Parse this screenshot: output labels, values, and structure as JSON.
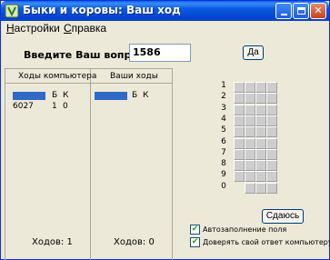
{
  "window": {
    "title": "Быки и коровы: Ваш ход",
    "icon": "bulls-and-cows-app-icon",
    "minimize": "minimize-icon",
    "maximize": "maximize-icon",
    "close": "✕"
  },
  "menu": {
    "items": [
      {
        "first": "Н",
        "rest": "астройки"
      },
      {
        "first": "С",
        "rest": "правка"
      }
    ]
  },
  "question": {
    "label": "Введите Ваш вопрос",
    "value": "1586",
    "submit_label": "Да"
  },
  "computer_moves": {
    "header": "Ходы компьютера",
    "bulls_label": "Б",
    "cows_label": "К",
    "rows": [
      {
        "guess": "6027",
        "bulls": "1",
        "cows": "0"
      }
    ],
    "count_label": "Ходов: 1"
  },
  "your_moves": {
    "header": "Ваши ходы",
    "bulls_label": "Б",
    "cows_label": "К",
    "rows": [],
    "count_label": "Ходов: 0"
  },
  "digits_grid": {
    "rows": [
      "1",
      "2",
      "3",
      "4",
      "5",
      "6",
      "7",
      "8",
      "9",
      "0"
    ]
  },
  "give_up_label": "Сдаюсь",
  "options": {
    "autofill_label": "Автозаполнение поля",
    "autofill_checked": true,
    "trust_label": "Доверять свой ответ компьютеру",
    "trust_checked": true
  },
  "colors": {
    "titlebar": "#0a58e0",
    "selection": "#316ac5",
    "check": "#21a121"
  }
}
